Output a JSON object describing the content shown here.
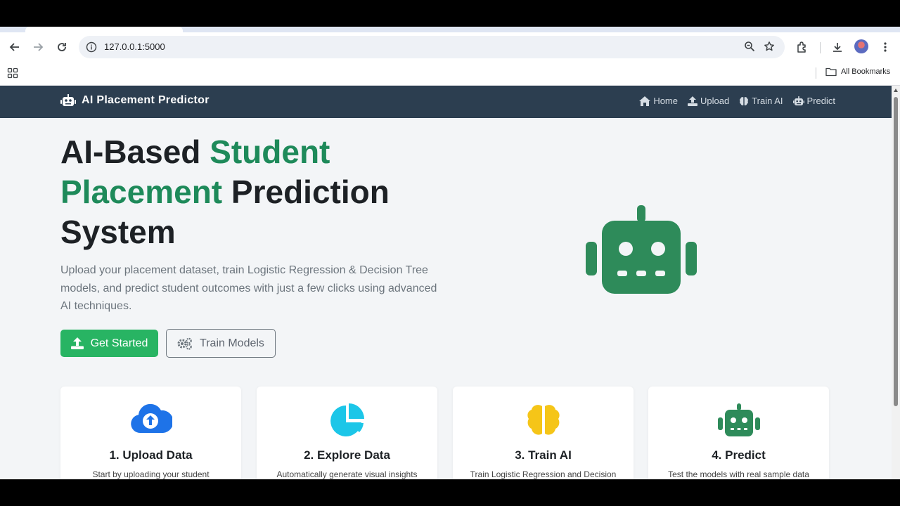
{
  "browser": {
    "url": "127.0.0.1:5000",
    "bookmarks_label": "All Bookmarks"
  },
  "navbar": {
    "brand": "AI Placement Predictor",
    "links": [
      {
        "label": "Home",
        "icon": "home-icon"
      },
      {
        "label": "Upload",
        "icon": "upload-icon"
      },
      {
        "label": "Train AI",
        "icon": "brain-icon"
      },
      {
        "label": "Predict",
        "icon": "robot-icon"
      }
    ]
  },
  "hero": {
    "title_part1": "AI-Based ",
    "title_green": "Student Placement",
    "title_part2": " Prediction System",
    "description": "Upload your placement dataset, train Logistic Regression & Decision Tree models, and predict student outcomes with just a few clicks using advanced AI techniques.",
    "primary_button": "Get Started",
    "secondary_button": "Train Models"
  },
  "cards": [
    {
      "title": "1. Upload Data",
      "text": "Start by uploading your student",
      "icon": "cloud-upload-icon",
      "color": "#1e73e8"
    },
    {
      "title": "2. Explore Data",
      "text": "Automatically generate visual insights",
      "icon": "pie-chart-icon",
      "color": "#1cc6e8"
    },
    {
      "title": "3. Train AI",
      "text": "Train Logistic Regression and Decision",
      "icon": "brain-icon",
      "color": "#f5c518"
    },
    {
      "title": "4. Predict",
      "text": "Test the models with real sample data",
      "icon": "robot-icon",
      "color": "#2e8b5a"
    }
  ],
  "colors": {
    "navbar": "#2c3e50",
    "accent_green": "#1e8a5a",
    "button_green": "#28b463"
  }
}
